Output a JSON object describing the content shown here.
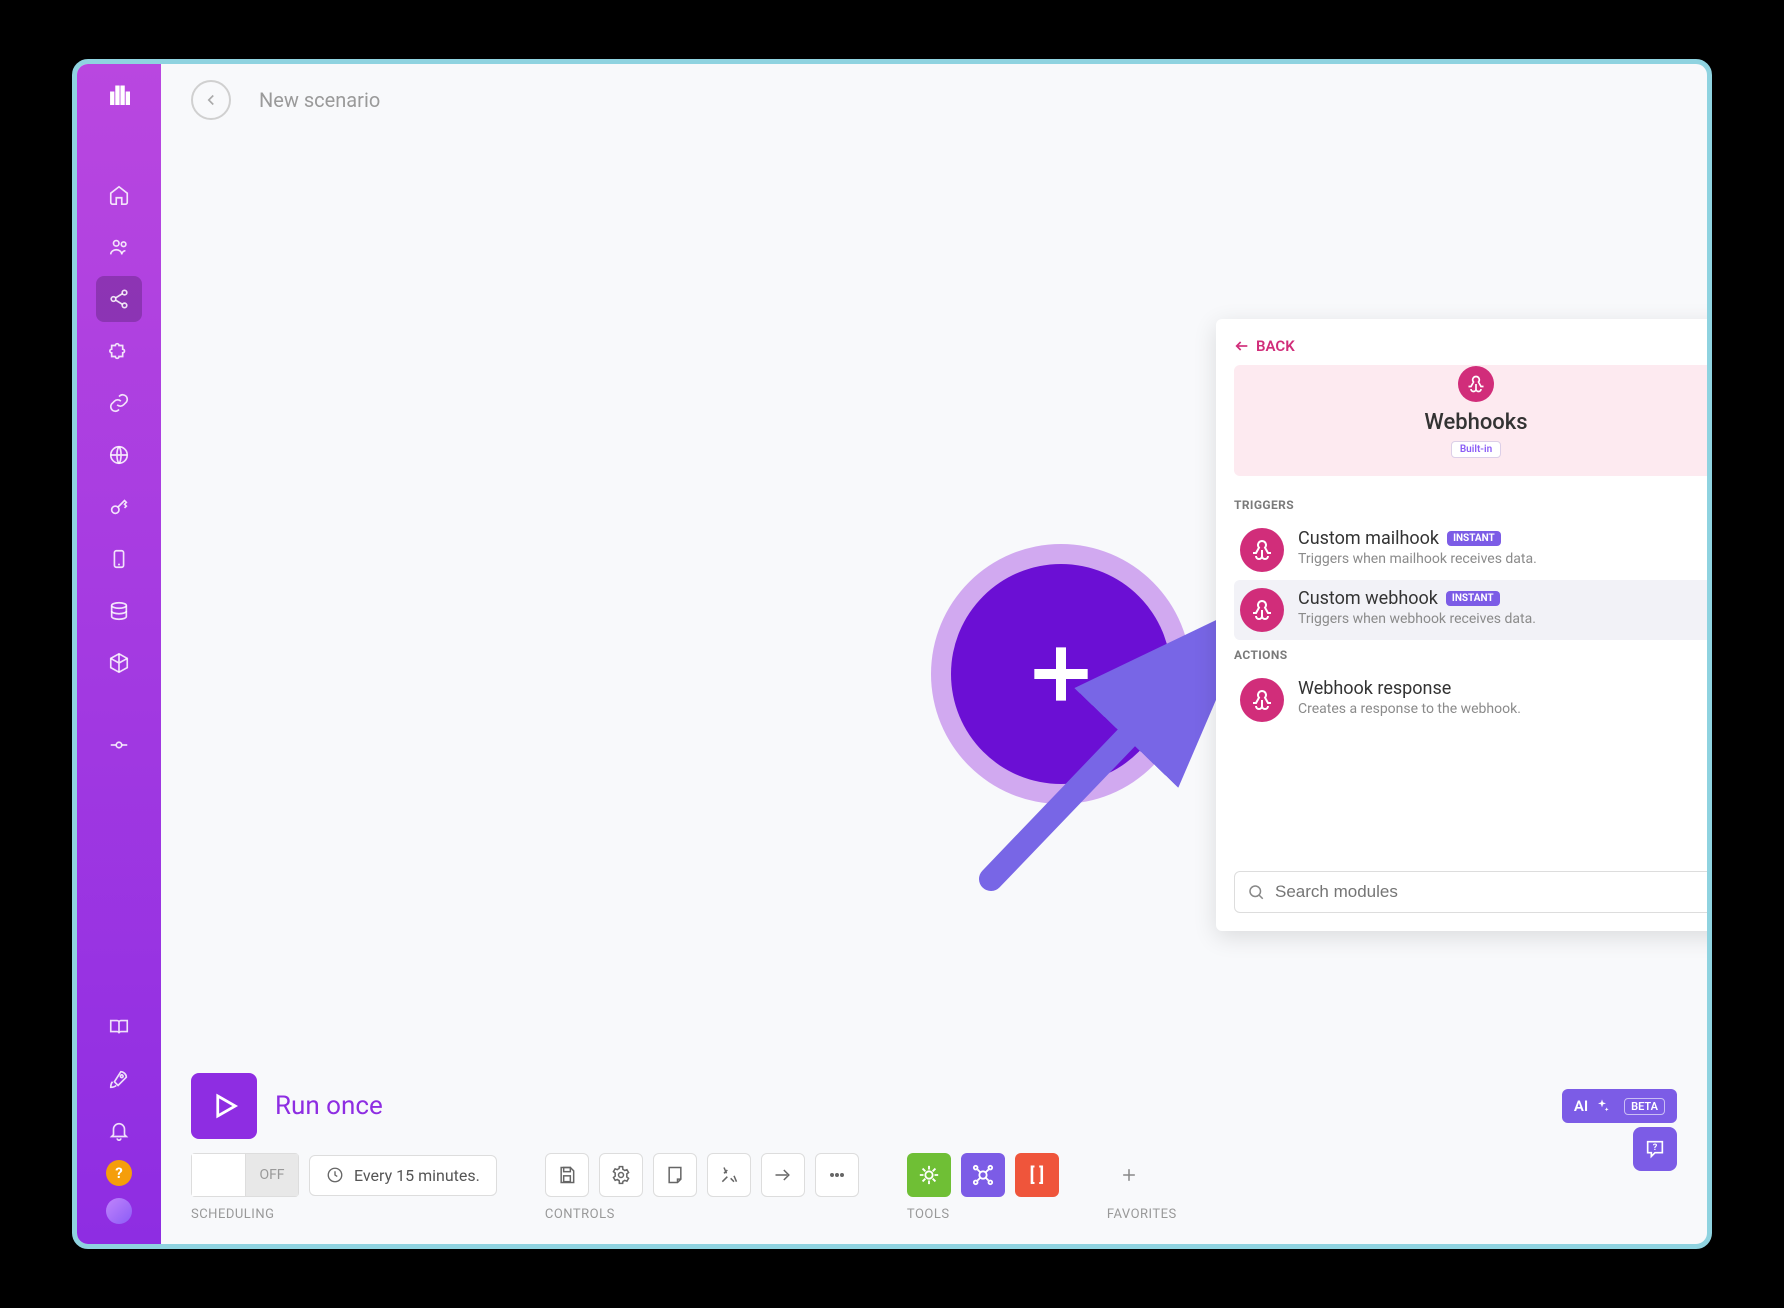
{
  "header": {
    "title": "New scenario"
  },
  "sidebar": {
    "icons": [
      "home",
      "users",
      "share",
      "puzzle",
      "link",
      "globe",
      "key",
      "tablet",
      "database",
      "cube",
      "commit"
    ],
    "active": "share"
  },
  "panel": {
    "back_label": "BACK",
    "title": "Webhooks",
    "builtin": "Built-in",
    "triggers_label": "TRIGGERS",
    "actions_label": "ACTIONS",
    "triggers": [
      {
        "title": "Custom mailhook",
        "instant": "INSTANT",
        "desc": "Triggers when mailhook receives data."
      },
      {
        "title": "Custom webhook",
        "instant": "INSTANT",
        "desc": "Triggers when webhook receives data."
      }
    ],
    "actions": [
      {
        "title": "Webhook response",
        "desc": "Creates a response to the webhook."
      }
    ],
    "search_placeholder": "Search modules"
  },
  "footer": {
    "run_label": "Run once",
    "switch_off": "OFF",
    "schedule_text": "Every 15 minutes.",
    "labels": {
      "scheduling": "SCHEDULING",
      "controls": "CONTROLS",
      "tools": "TOOLS",
      "favorites": "FAVORITES"
    },
    "ai_label": "AI",
    "ai_beta": "BETA"
  }
}
